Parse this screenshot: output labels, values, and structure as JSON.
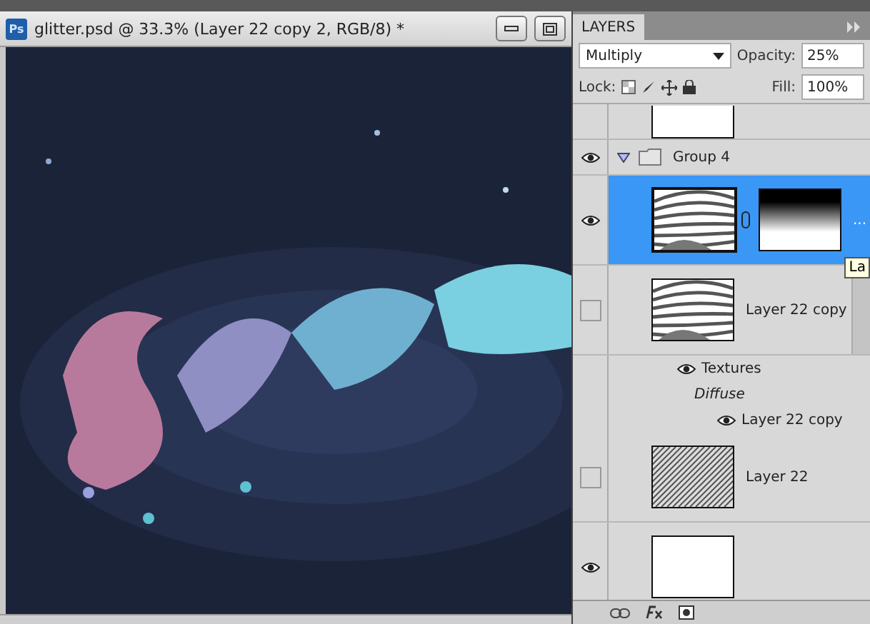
{
  "document": {
    "app_badge": "Ps",
    "title": "glitter.psd @ 33.3% (Layer 22 copy 2, RGB/8) *"
  },
  "layers_panel": {
    "tab": "LAYERS",
    "blend_mode": "Multiply",
    "opacity_label": "Opacity:",
    "opacity": "25%",
    "lock_label": "Lock:",
    "fill_label": "Fill:",
    "fill": "100%",
    "layers": [
      {
        "kind": "cut",
        "thumb": {
          "kind": "white"
        },
        "visible": false,
        "selected": false
      },
      {
        "kind": "group",
        "name": "Group 4",
        "visible": true,
        "expanded": true,
        "selected": false
      },
      {
        "kind": "masked",
        "thumb": {
          "kind": "swirl"
        },
        "mask": {
          "kind": "gradient"
        },
        "name": "...",
        "visible": true,
        "selected": true,
        "tooltip": "La"
      },
      {
        "kind": "smart",
        "thumb": {
          "kind": "swirl"
        },
        "name": "Layer 22 copy",
        "visible": false,
        "selected": false,
        "effects": [
          {
            "kind": "heading",
            "label": "Textures",
            "visible": true
          },
          {
            "kind": "filter",
            "label": "Diffuse"
          },
          {
            "kind": "item",
            "label": "Layer 22 copy",
            "visible": true
          }
        ]
      },
      {
        "kind": "layer",
        "thumb": {
          "kind": "hatch"
        },
        "name": "Layer 22",
        "visible": false,
        "selected": false
      },
      {
        "kind": "layer",
        "thumb": {
          "kind": "white"
        },
        "visible": true,
        "selected": false
      }
    ]
  }
}
